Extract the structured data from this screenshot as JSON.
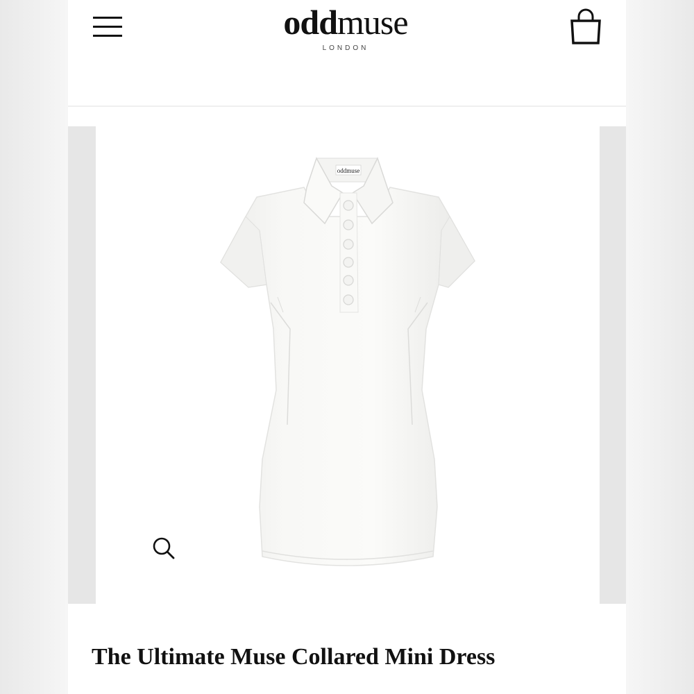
{
  "header": {
    "logo_primary": "odd",
    "logo_secondary": "muse",
    "logo_subtitle": "LONDON",
    "menu_icon": "hamburger-menu-icon",
    "cart_icon": "shopping-bag-icon"
  },
  "product": {
    "title": "The Ultimate Muse Collared Mini Dress",
    "label_text": "oddmuse",
    "zoom_icon": "magnifier-icon",
    "color": "#f7f7f5"
  }
}
